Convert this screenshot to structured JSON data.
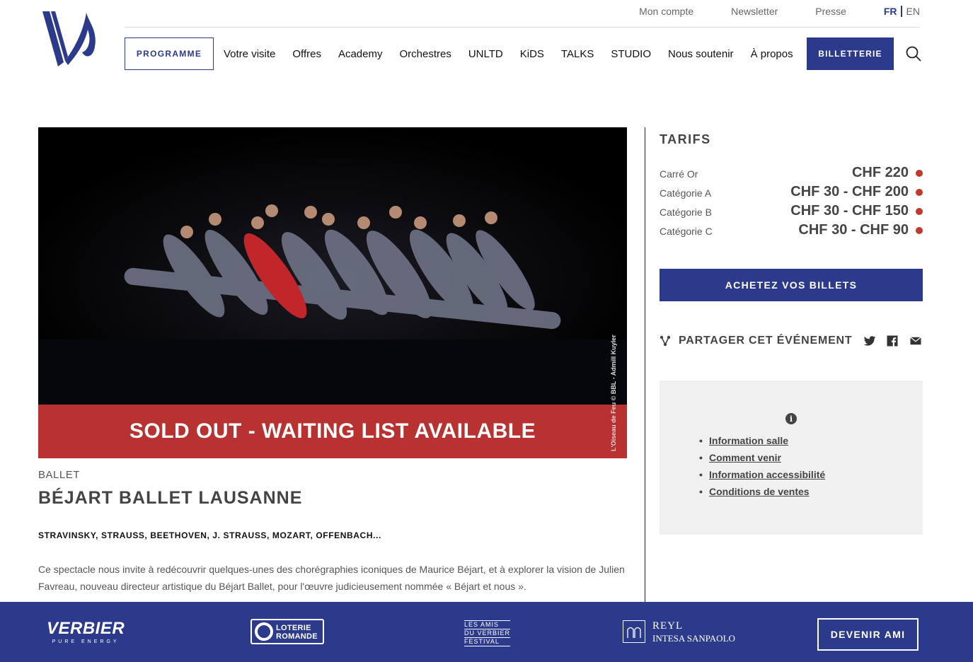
{
  "header": {
    "top_links": [
      "Mon compte",
      "Newsletter",
      "Presse"
    ],
    "lang_fr": "FR",
    "lang_en": "EN",
    "programme": "PROGRAMME",
    "nav": [
      "Votre visite",
      "Offres",
      "Academy",
      "Orchestres",
      "UNLTD",
      "KiDS",
      "TALKS",
      "STUDIO",
      "Nous soutenir",
      "À propos"
    ],
    "billetterie": "BILLETTERIE"
  },
  "hero": {
    "banner": "SOLD OUT - WAITING LIST AVAILABLE",
    "credit": "L'Oiseau de Feu © BBL - Admill Kuyler"
  },
  "event": {
    "category": "BALLET",
    "title": "BÉJART BALLET LAUSANNE",
    "composers": "STRAVINSKY, STRAUSS, BEETHOVEN, J. STRAUSS, MOZART, OFFENBACH...",
    "description": "Ce spectacle nous invite à redécouvrir quelques-unes des chorégraphies iconiques de Maurice Béjart, et à explorer la vision de Julien Favreau, nouveau directeur artistique du Béjart Ballet, pour l'œuvre judicieusement nommée « Béjart et nous »."
  },
  "tarifs": {
    "title": "TARIFS",
    "rows": [
      {
        "label": "Carré Or",
        "price": "CHF 220"
      },
      {
        "label": "Catégorie A",
        "price": "CHF 30 - CHF 200"
      },
      {
        "label": "Catégorie B",
        "price": "CHF 30 - CHF 150"
      },
      {
        "label": "Catégorie C",
        "price": "CHF 30 - CHF 90"
      }
    ],
    "dot_color": "#c0392b"
  },
  "buy_button": "ACHETEZ VOS BILLETS",
  "share": {
    "label": "PARTAGER CET ÉVÉNEMENT",
    "icons": [
      "twitter-icon",
      "facebook-icon",
      "mail-icon"
    ]
  },
  "info": {
    "icon": "i",
    "links": [
      "Information salle",
      "Comment venir",
      "Information accessibilité",
      "Conditions de ventes"
    ]
  },
  "footer": {
    "verbier": "VERBIER",
    "verbier_tag": "PURE ENERGY",
    "loterie_1": "LOTERIE",
    "loterie_2": "ROMANDE",
    "amis": [
      "LES AMIS",
      "DU VERBIER",
      "FESTIVAL"
    ],
    "reyl_1": "REYL",
    "reyl_2": "INTESA SANPAOLO",
    "devenir_ami": "DEVENIR AMI"
  },
  "colors": {
    "brand": "#2c3a8b",
    "banner": "#b83232"
  }
}
